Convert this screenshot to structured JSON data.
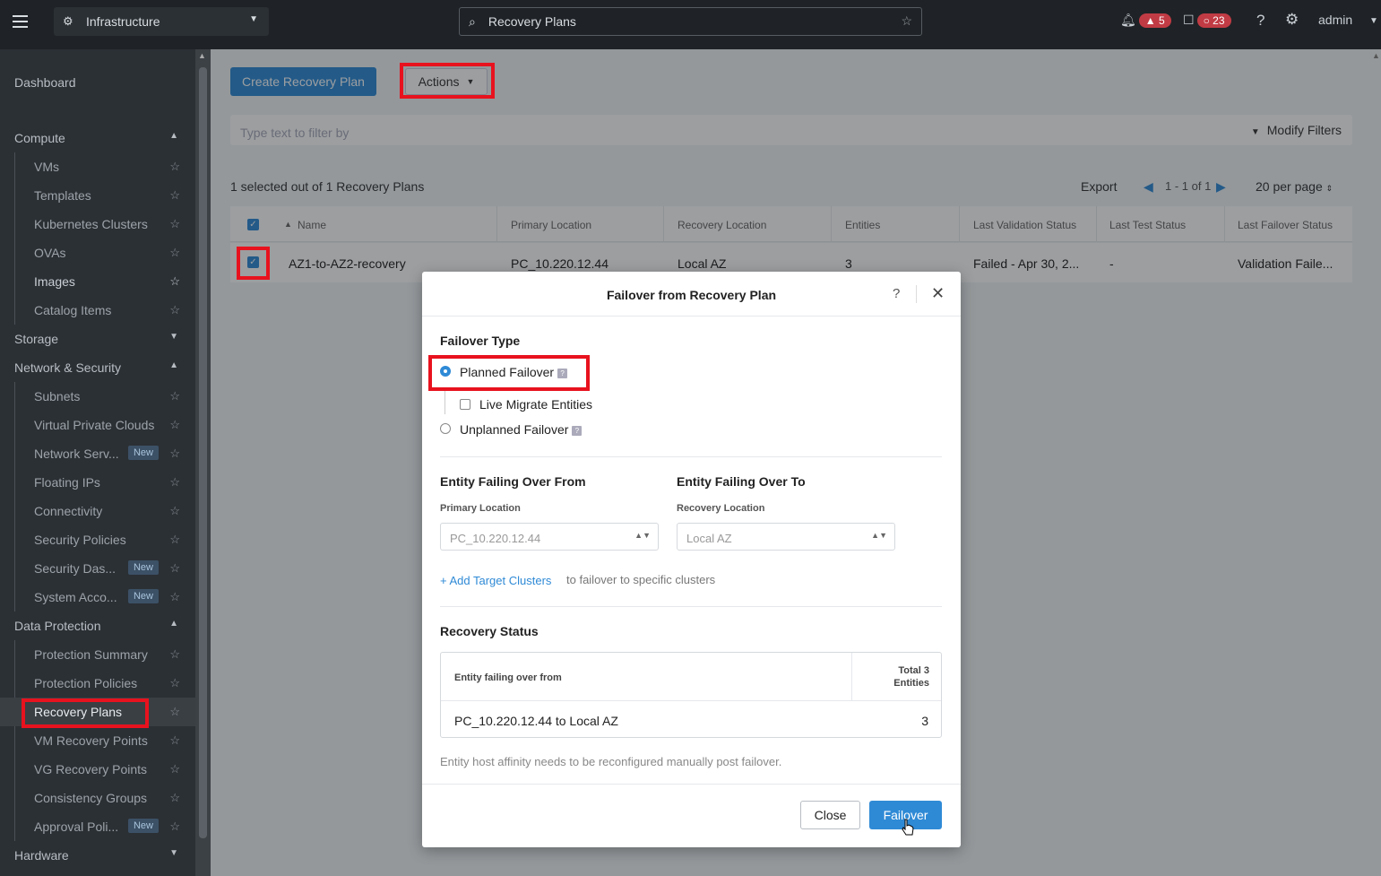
{
  "topbar": {
    "app_switcher": "Infrastructure",
    "search_value": "Recovery Plans",
    "alerts_count": "5",
    "tasks_count": "23",
    "help": "?",
    "user": "admin"
  },
  "sidebar": {
    "dashboard": "Dashboard",
    "compute": {
      "label": "Compute",
      "items": [
        "VMs",
        "Templates",
        "Kubernetes Clusters",
        "OVAs",
        "Images",
        "Catalog Items"
      ]
    },
    "storage": "Storage",
    "network": {
      "label": "Network & Security",
      "items": [
        "Subnets",
        "Virtual Private Clouds",
        "Network Serv...",
        "Floating IPs",
        "Connectivity",
        "Security Policies",
        "Security Das...",
        "System Acco..."
      ]
    },
    "data_protection": {
      "label": "Data Protection",
      "items": [
        "Protection Summary",
        "Protection Policies",
        "Recovery Plans",
        "VM Recovery Points",
        "VG Recovery Points",
        "Consistency Groups",
        "Approval Poli..."
      ]
    },
    "hardware": "Hardware",
    "new_badge": "New"
  },
  "toolbar": {
    "create_label": "Create Recovery Plan",
    "actions_label": "Actions",
    "filter_placeholder": "Type text to filter by",
    "modify_filters": "Modify Filters"
  },
  "listing": {
    "summary": "1 selected out of 1 Recovery Plans",
    "export": "Export",
    "range": "1 - 1 of 1",
    "per_page": "20 per page"
  },
  "table": {
    "headers": [
      "Name",
      "Primary Location",
      "Recovery Location",
      "Entities",
      "Last Validation Status",
      "Last Test Status",
      "Last Failover Status"
    ],
    "row": [
      "AZ1-to-AZ2-recovery",
      "PC_10.220.12.44",
      "Local AZ",
      "3",
      "Failed - Apr 30, 2...",
      "-",
      "Validation Faile..."
    ]
  },
  "modal": {
    "title": "Failover from Recovery Plan",
    "help": "?",
    "failover_type": "Failover Type",
    "planned": "Planned Failover",
    "live_migrate": "Live Migrate Entities",
    "unplanned": "Unplanned Failover",
    "from_heading": "Entity Failing Over From",
    "to_heading": "Entity Failing Over To",
    "primary_label": "Primary Location",
    "primary_value": "PC_10.220.12.44",
    "recovery_label": "Recovery Location",
    "recovery_value": "Local AZ",
    "add_target": "+ Add Target Clusters",
    "add_target_suffix": "to failover to specific clusters",
    "status_heading": "Recovery Status",
    "status_col1": "Entity failing over from",
    "status_col2_line1": "Total 3",
    "status_col2_line2": "Entities",
    "status_row": "PC_10.220.12.44 to Local AZ",
    "status_row_count": "3",
    "note": "Entity host affinity needs to be reconfigured manually post failover.",
    "close_label": "Close",
    "failover_label": "Failover"
  },
  "colors": {
    "accent": "#2f8ad6",
    "highlight": "#e8121e",
    "alert": "#c13b44"
  }
}
